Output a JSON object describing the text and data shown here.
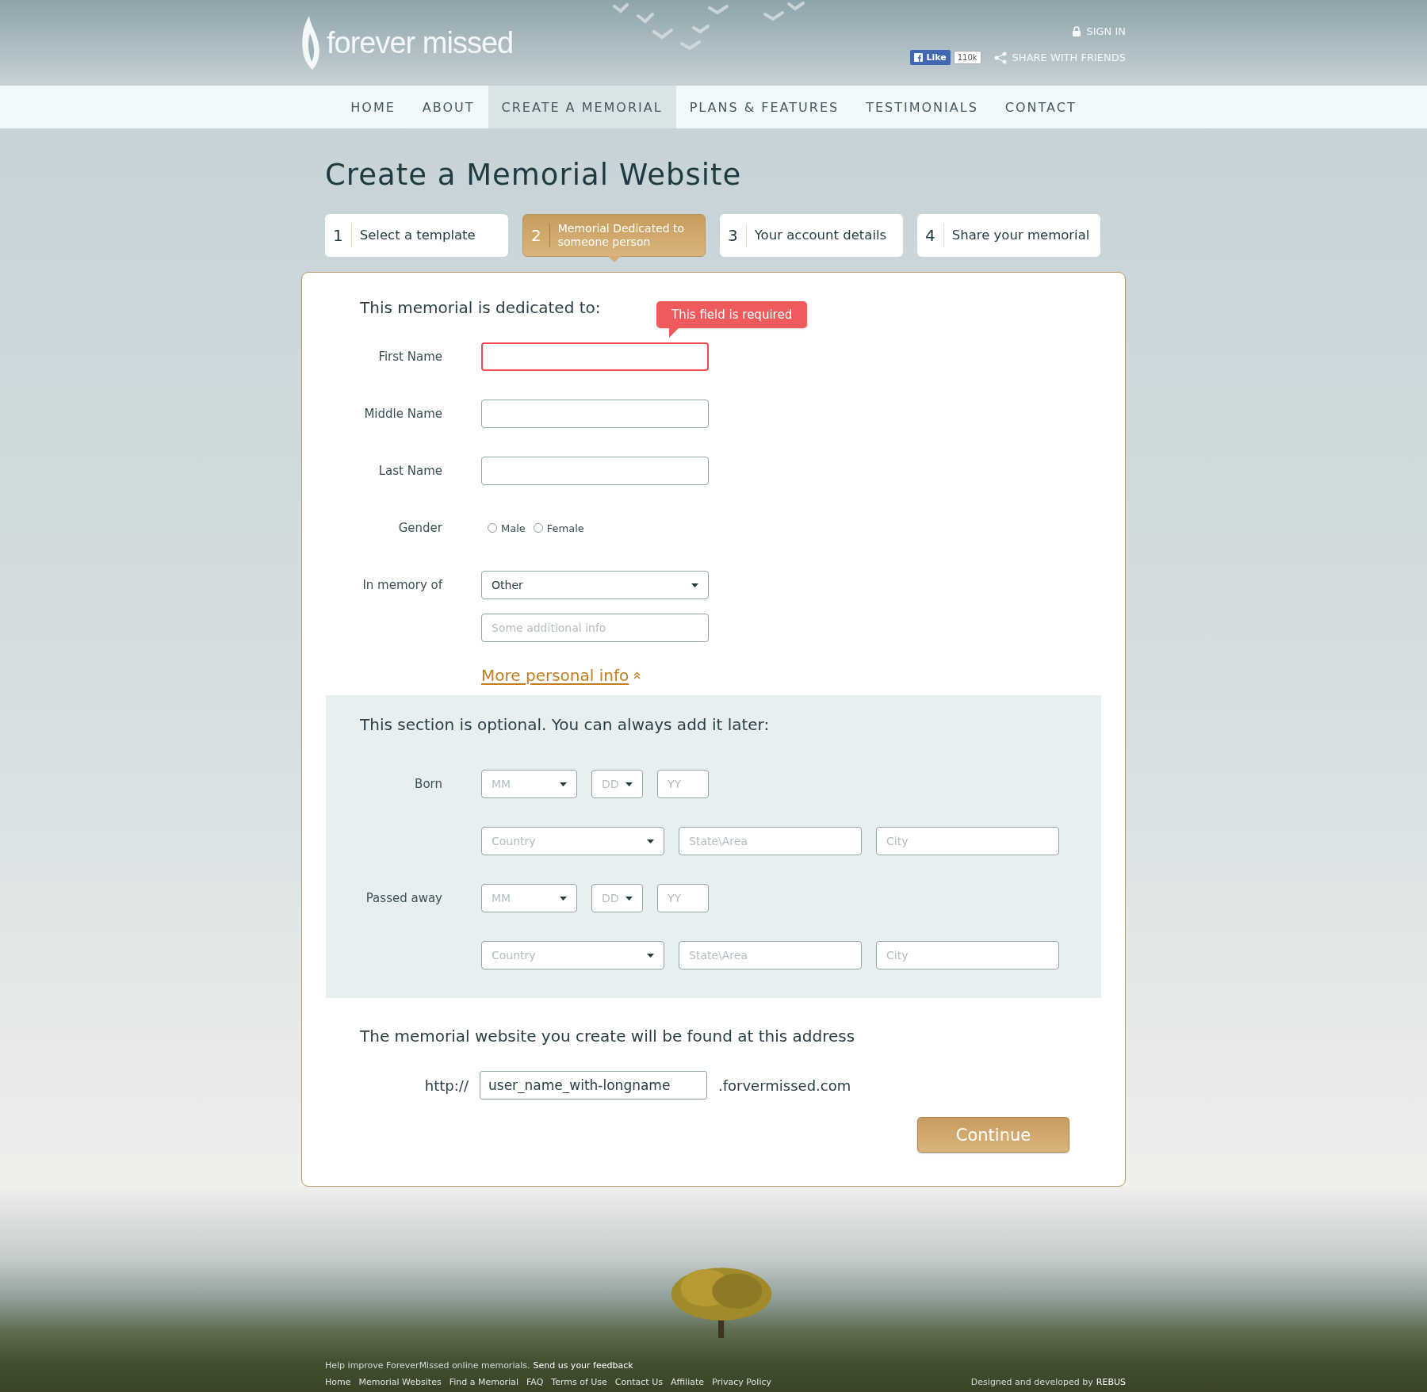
{
  "header": {
    "logo": "forever missed",
    "sign_in": "SIGN IN",
    "like": {
      "label": "Like",
      "count": "110k"
    },
    "share": "SHARE WITH FRIENDS"
  },
  "nav": [
    {
      "label": "HOME",
      "selected": false
    },
    {
      "label": "ABOUT",
      "selected": false
    },
    {
      "label": "CREATE A MEMORIAL",
      "selected": true
    },
    {
      "label": "PLANS & FEATURES",
      "selected": false
    },
    {
      "label": "TESTIMONIALS",
      "selected": false
    },
    {
      "label": "CONTACT",
      "selected": false
    }
  ],
  "title": "Create a Memorial Website",
  "steps": [
    {
      "number": "1",
      "label": "Select a template",
      "selected": false
    },
    {
      "number": "2",
      "label": "Memorial Dedicated to someone person",
      "selected": true
    },
    {
      "number": "3",
      "label": "Your account details",
      "selected": false
    },
    {
      "number": "4",
      "label": "Share your memorial",
      "selected": false
    }
  ],
  "dedication": {
    "heading": "This memorial is dedicated to:",
    "fields": [
      {
        "kind": "text",
        "label": "First Name",
        "error": "This field is required"
      },
      {
        "kind": "text",
        "label": "Middle Name"
      },
      {
        "kind": "text",
        "label": "Last Name"
      },
      {
        "kind": "radio",
        "label": "Gender",
        "options": [
          {
            "label": "Male",
            "selected": false
          },
          {
            "label": "Female",
            "selected": false
          }
        ]
      },
      {
        "kind": "select",
        "label": "In memory of",
        "value": "Other",
        "extra_placeholder": "Some additional info"
      }
    ],
    "more_link": "More personal info"
  },
  "optional": {
    "heading": "This section is optional. You can always add it later:",
    "events": [
      {
        "label": "Born",
        "month": "MM",
        "day": "DD",
        "year_placeholder": "YY",
        "country": "Country",
        "state_placeholder": "State\\Area",
        "city_placeholder": "City"
      },
      {
        "label": "Passed away",
        "month": "MM",
        "day": "DD",
        "year_placeholder": "YY",
        "country": "Country",
        "state_placeholder": "State\\Area",
        "city_placeholder": "City"
      }
    ]
  },
  "address": {
    "heading": "The memorial website you create will be found at this address",
    "prefix": "http://",
    "value": "user_name_with-longname",
    "suffix": ".forvermissed.com"
  },
  "continue_button": "Continue",
  "footer": {
    "feedback_text": "Help improve ForeverMissed online memorials.",
    "feedback_link": "Send us your feedback",
    "links": [
      "Home",
      "Memorial Websites",
      "Find a Memorial",
      "FAQ",
      "Terms of Use",
      "Contact Us",
      "Affiliate",
      "Privacy Policy"
    ],
    "credit": "Designed and developed by",
    "credit_brand": "REBUS"
  }
}
